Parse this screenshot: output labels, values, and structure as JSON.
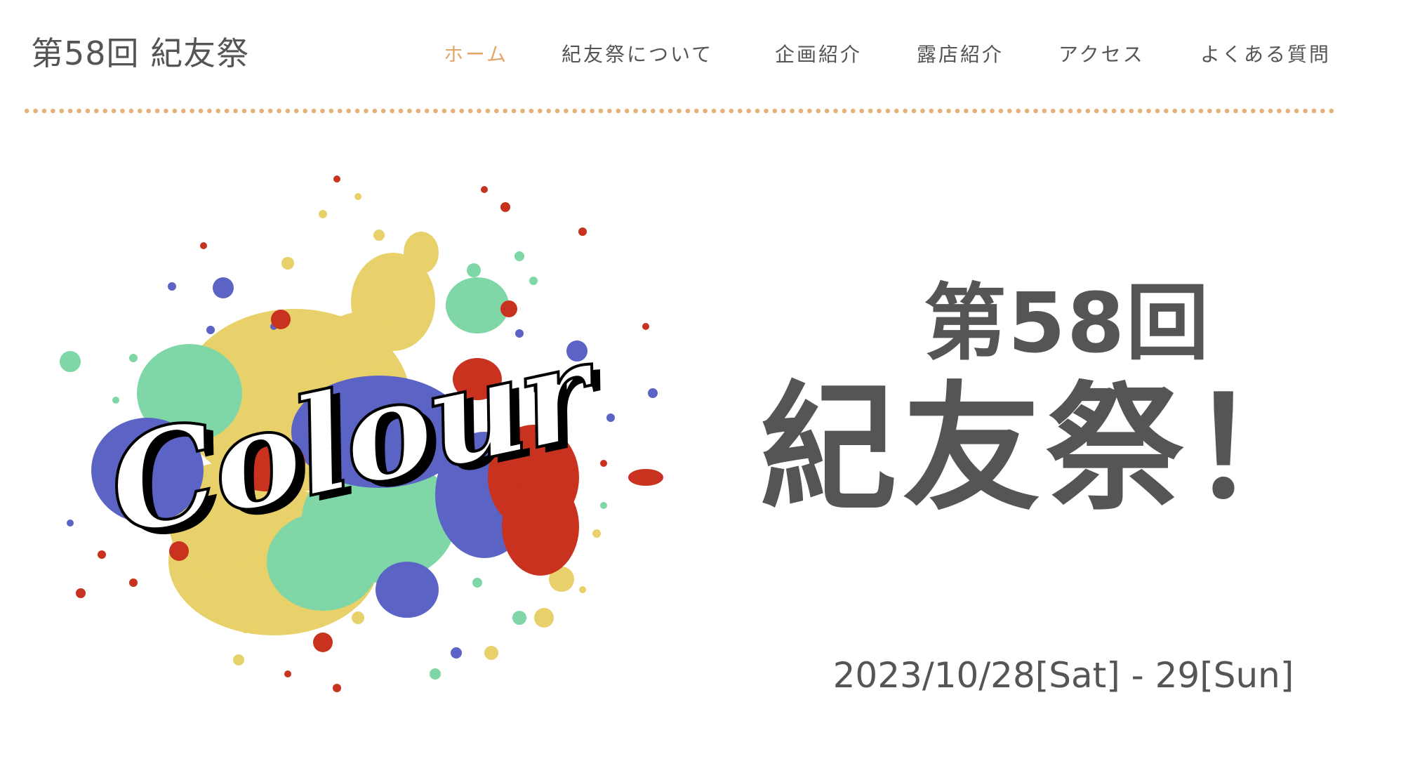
{
  "header": {
    "site_title": "第58回 紀友祭"
  },
  "nav": {
    "items": [
      {
        "label": "ホーム",
        "active": true
      },
      {
        "label": "紀友祭について",
        "active": false
      },
      {
        "label": "企画紹介",
        "active": false
      },
      {
        "label": "露店紹介",
        "active": false
      },
      {
        "label": "アクセス",
        "active": false
      },
      {
        "label": "よくある質問",
        "active": false
      }
    ]
  },
  "hero": {
    "logo_text": "Colour",
    "edition": "第58回",
    "festival_name": "紀友祭！",
    "dates": "2023/10/28[Sat] - 29[Sun]"
  },
  "colors": {
    "text": "#555555",
    "accent": "#e3a66b",
    "splash_yellow": "#e8d06a",
    "splash_blue": "#5b63c4",
    "splash_red": "#c8321f",
    "splash_green": "#7fd6a6"
  },
  "icons": [
    "paint-splash-logo"
  ]
}
